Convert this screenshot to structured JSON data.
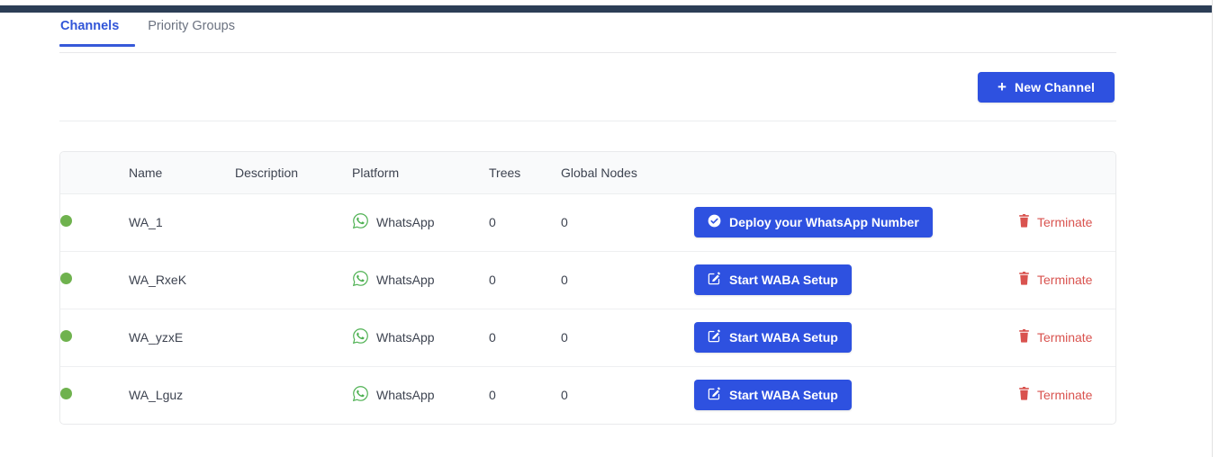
{
  "theme": {
    "topbar_color": "#2c3e56",
    "accent_blue": "#2e51e0",
    "tab_active_color": "#3155d8",
    "status_green": "#6fb24e",
    "whatsapp_green": "#4cb050",
    "danger_red": "#d9534f",
    "header_bg": "#f9fafb"
  },
  "tabs": [
    {
      "label": "Channels",
      "active": true
    },
    {
      "label": "Priority Groups",
      "active": false
    }
  ],
  "toolbar": {
    "new_channel_label": "New Channel",
    "new_channel_icon": "plus-icon"
  },
  "table": {
    "columns": [
      {
        "key": "status",
        "label": ""
      },
      {
        "key": "name",
        "label": "Name"
      },
      {
        "key": "description",
        "label": "Description"
      },
      {
        "key": "platform",
        "label": "Platform"
      },
      {
        "key": "trees",
        "label": "Trees"
      },
      {
        "key": "global_nodes",
        "label": "Global Nodes"
      },
      {
        "key": "action",
        "label": ""
      },
      {
        "key": "terminate",
        "label": ""
      }
    ],
    "rows": [
      {
        "status": "online",
        "name": "WA_1",
        "description": "",
        "platform": "WhatsApp",
        "platform_icon": "whatsapp-icon",
        "trees": "0",
        "global_nodes": "0",
        "action_label": "Deploy your WhatsApp Number",
        "action_icon": "check-circle-icon",
        "terminate_label": "Terminate",
        "terminate_icon": "trash-icon"
      },
      {
        "status": "online",
        "name": "WA_RxeK",
        "description": "",
        "platform": "WhatsApp",
        "platform_icon": "whatsapp-icon",
        "trees": "0",
        "global_nodes": "0",
        "action_label": "Start WABA Setup",
        "action_icon": "edit-square-icon",
        "terminate_label": "Terminate",
        "terminate_icon": "trash-icon"
      },
      {
        "status": "online",
        "name": "WA_yzxE",
        "description": "",
        "platform": "WhatsApp",
        "platform_icon": "whatsapp-icon",
        "trees": "0",
        "global_nodes": "0",
        "action_label": "Start WABA Setup",
        "action_icon": "edit-square-icon",
        "terminate_label": "Terminate",
        "terminate_icon": "trash-icon"
      },
      {
        "status": "online",
        "name": "WA_Lguz",
        "description": "",
        "platform": "WhatsApp",
        "platform_icon": "whatsapp-icon",
        "trees": "0",
        "global_nodes": "0",
        "action_label": "Start WABA Setup",
        "action_icon": "edit-square-icon",
        "terminate_label": "Terminate",
        "terminate_icon": "trash-icon"
      }
    ]
  }
}
